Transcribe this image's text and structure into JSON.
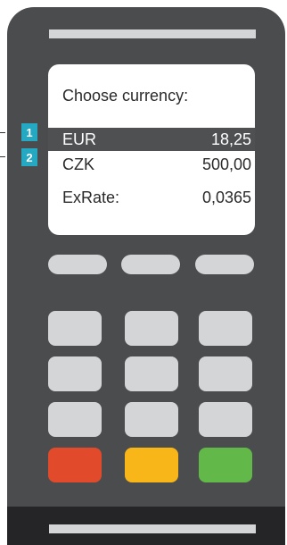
{
  "screen": {
    "title": "Choose currency:",
    "rows": [
      {
        "label": "EUR",
        "value": "18,25",
        "selected": true
      },
      {
        "label": "CZK",
        "value": "500,00",
        "selected": false
      },
      {
        "label": "ExRate:",
        "value": "0,0365",
        "selected": false
      }
    ]
  },
  "badges": [
    "1",
    "2"
  ],
  "colors": {
    "device_body": "#4a4c4e",
    "badge": "#25a9c2",
    "cancel_key": "#e14a2b",
    "clear_key": "#f8b619",
    "ok_key": "#62b849"
  }
}
